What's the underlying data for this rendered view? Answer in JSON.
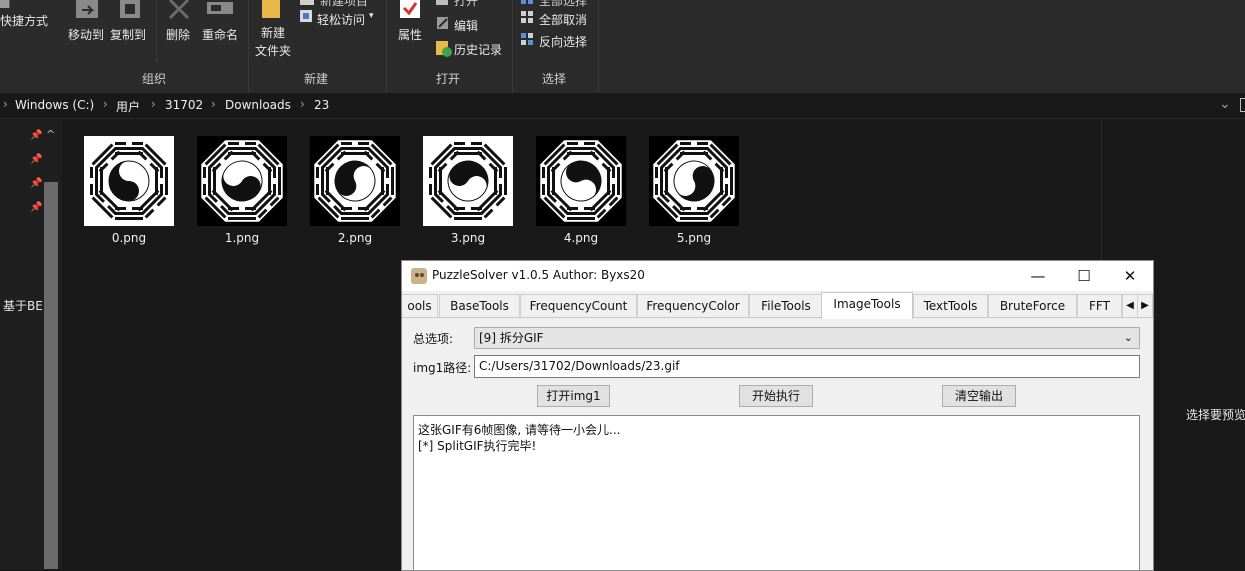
{
  "ribbon": {
    "partial_top_left_1": "快捷方式",
    "move_to": "移动到",
    "copy_to": "复制到",
    "delete": "删除",
    "rename": "重命名",
    "group_organize": "组织",
    "new_folder_line1": "新建",
    "new_folder_line2": "文件夹",
    "easy_access": "轻松访问",
    "group_new": "新建",
    "properties": "属性",
    "edit": "编辑",
    "history": "历史记录",
    "group_open": "打开",
    "select_none": "全部取消",
    "invert_selection": "反向选择",
    "group_select": "选择"
  },
  "address": {
    "crumbs": [
      "Windows (C:)",
      "用户",
      "31702",
      "Downloads",
      "23"
    ]
  },
  "nav": {
    "partial_label": "基于BE"
  },
  "preview_pane": {
    "partial_text": "选择要预览"
  },
  "files": [
    {
      "name": "0.png"
    },
    {
      "name": "1.png"
    },
    {
      "name": "2.png"
    },
    {
      "name": "3.png"
    },
    {
      "name": "4.png"
    },
    {
      "name": "5.png"
    }
  ],
  "dialog": {
    "title": "PuzzleSolver v1.0.5  Author:  Byxs20",
    "tabs": [
      "ools",
      "BaseTools",
      "FrequencyCount",
      "FrequencyColor",
      "FileTools",
      "ImageTools",
      "TextTools",
      "BruteForce",
      "FFT"
    ],
    "active_tab": "ImageTools",
    "option_label": "总选项:",
    "option_value": "[9] 拆分GIF",
    "img1_label": "img1路径:",
    "img1_value": "C:/Users/31702/Downloads/23.gif",
    "open_button": "打开img1",
    "run_button": "开始执行",
    "clear_button": "清空输出",
    "output_lines": [
      "这张GIF有6帧图像, 请等待一小会儿...",
      "[*] SplitGIF执行完毕!"
    ]
  },
  "colors": {
    "explorer_bg": "#191919",
    "ribbon_bg": "#2b2b2b",
    "dialog_bg": "#f0f0f0"
  }
}
